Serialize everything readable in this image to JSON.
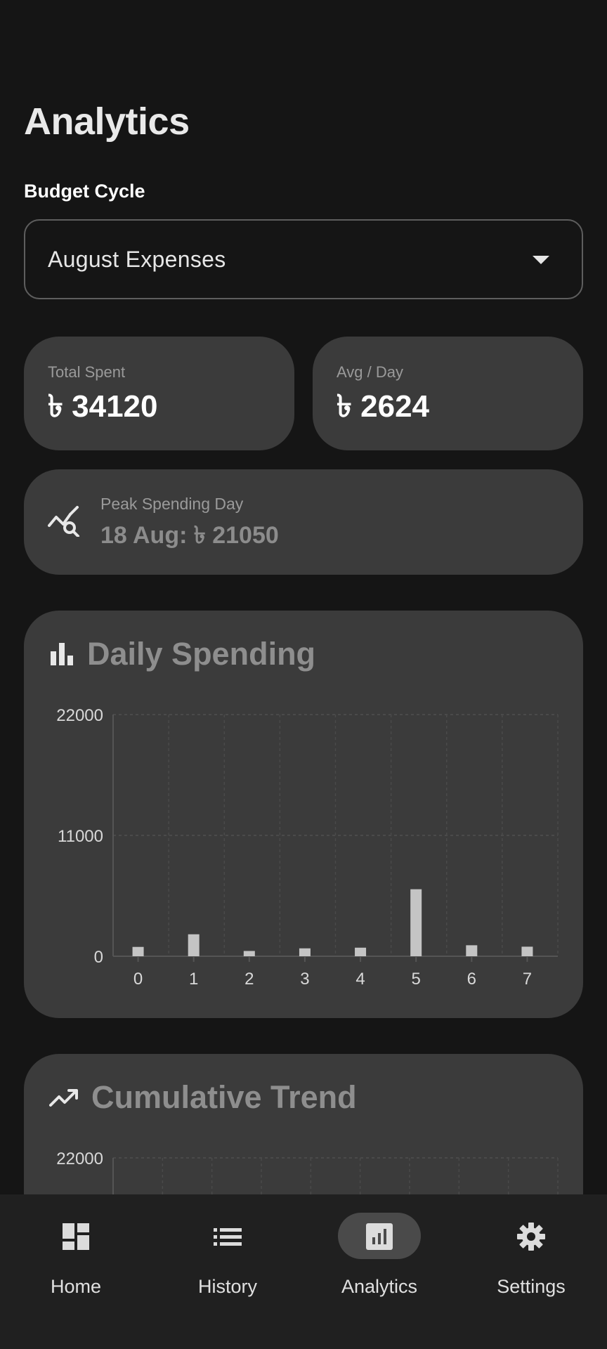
{
  "header": {
    "title": "Analytics"
  },
  "budget_cycle": {
    "label": "Budget Cycle",
    "selected": "August Expenses"
  },
  "stats": {
    "total_spent": {
      "label": "Total Spent",
      "value": "৳ 34120"
    },
    "avg_day": {
      "label": "Avg / Day",
      "value": "৳ 2624"
    },
    "peak": {
      "label": "Peak Spending Day",
      "value": "18 Aug: ৳ 21050"
    }
  },
  "daily_chart": {
    "title": "Daily Spending",
    "icon": "bar-chart-icon"
  },
  "cumulative_chart": {
    "title": "Cumulative Trend",
    "icon": "trending-up-icon",
    "visible_ytick": "22000"
  },
  "chart_data": [
    {
      "type": "bar",
      "categories": [
        "0",
        "1",
        "2",
        "3",
        "4",
        "5",
        "6",
        "7"
      ],
      "values": [
        850,
        2000,
        480,
        720,
        780,
        6100,
        1000,
        870
      ],
      "yticks": [
        "22000",
        "11000",
        "0"
      ],
      "ylim": [
        0,
        22000
      ],
      "xlabel": "",
      "ylabel": "",
      "grid": true,
      "bar_color": "#c4c4c4"
    },
    {
      "type": "line",
      "yticks": [
        "22000"
      ],
      "ylim": [
        0,
        22000
      ],
      "grid": true,
      "line_color": "#ffffff"
    }
  ],
  "nav": {
    "items": [
      {
        "label": "Home",
        "icon": "dashboard-icon",
        "active": false
      },
      {
        "label": "History",
        "icon": "list-icon",
        "active": false
      },
      {
        "label": "Analytics",
        "icon": "analytics-icon",
        "active": true
      },
      {
        "label": "Settings",
        "icon": "gear-icon",
        "active": false
      }
    ]
  },
  "colors": {
    "background": "#151515",
    "card": "#3b3b3b",
    "nav": "#202020",
    "accent_pill": "#4a4a4a"
  }
}
